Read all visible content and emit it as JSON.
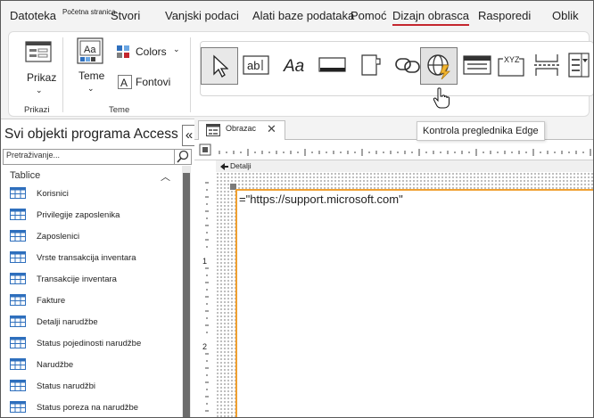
{
  "ribbon": {
    "tabs": [
      {
        "label": "Datoteka"
      },
      {
        "label": "Početna stranica"
      },
      {
        "label": "Stvori"
      },
      {
        "label": "Vanjski podaci"
      },
      {
        "label": "Alati baze podataka"
      },
      {
        "label": "Pomoć"
      },
      {
        "label": "Dizajn obrasca"
      },
      {
        "label": "Rasporedi"
      },
      {
        "label": "Oblik"
      }
    ],
    "active_tab": "Dizajn obrasca",
    "groups": {
      "views": {
        "label": "Prikazi",
        "view_button": "Prikaz"
      },
      "themes": {
        "label": "Teme",
        "themes_button": "Teme",
        "colors_button": "Colors",
        "fonts_button": "Fontovi"
      }
    },
    "controls": [
      {
        "icon": "select-arrow-icon"
      },
      {
        "icon": "textbox-icon",
        "text": "ab|"
      },
      {
        "icon": "label-icon",
        "text": "Aa"
      },
      {
        "icon": "button-icon"
      },
      {
        "icon": "tab-control-icon"
      },
      {
        "icon": "hyperlink-icon"
      },
      {
        "icon": "edge-browser-control-icon"
      },
      {
        "icon": "navigation-control-icon"
      },
      {
        "icon": "option-group-icon",
        "text": "XYZ"
      },
      {
        "icon": "page-break-icon"
      },
      {
        "icon": "combo-box-icon"
      }
    ]
  },
  "tooltip": "Kontrola preglednika Edge",
  "nav_pane": {
    "title": "Svi objekti programa Access",
    "close_glyph": "«",
    "search_placeholder": "Pretraživanje...",
    "section": "Tablice",
    "items": [
      {
        "label": "Korisnici"
      },
      {
        "label": "Privilegije zaposlenika"
      },
      {
        "label": "Zaposlenici"
      },
      {
        "label": "Vrste transakcija inventara"
      },
      {
        "label": "Transakcije inventara"
      },
      {
        "label": "Fakture"
      },
      {
        "label": "Detalji narudžbe"
      },
      {
        "label": "Status pojedinosti narudžbe"
      },
      {
        "label": "Narudžbe"
      },
      {
        "label": "Status narudžbi"
      },
      {
        "label": "Status poreza na narudžbe"
      }
    ]
  },
  "document": {
    "tab_label": "Obrazac",
    "section_label": "Detalji",
    "ruler_marks": [
      "1",
      "2"
    ],
    "control_source": "=\"https://support.microsoft.com\""
  },
  "colors": {
    "active_tab_underline": "#c4262e",
    "selection_border": "#f0a030",
    "nav_scroll_thumb": "#6c6c6c"
  }
}
